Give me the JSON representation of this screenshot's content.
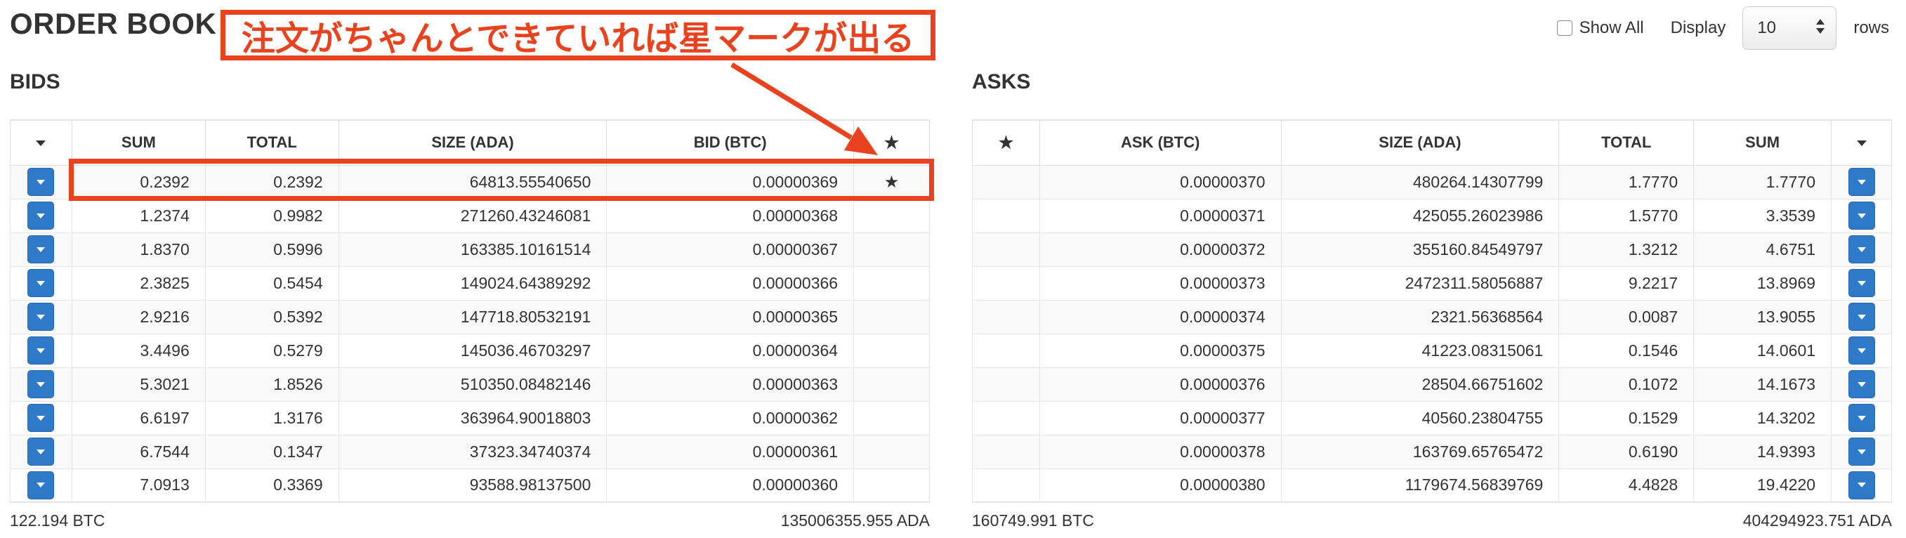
{
  "page": {
    "title": "ORDER BOOK"
  },
  "controls": {
    "show_all_label": "Show All",
    "display_label": "Display",
    "rows_value": "10",
    "rows_label": "rows"
  },
  "colors": {
    "accent": "#e8431e",
    "button": "#2f79c9",
    "stripe": "#f9f9f9"
  },
  "icons": {
    "sort": "caret-down-icon",
    "star": "star-icon",
    "row_button": "caret-down-icon"
  },
  "annotation": {
    "text": "注文がちゃんとできていれば星マークが出る"
  },
  "bids": {
    "title": "BIDS",
    "headers": {
      "sum": "SUM",
      "total": "TOTAL",
      "size": "SIZE (ADA)",
      "price": "BID (BTC)",
      "star": "★"
    },
    "rows": [
      {
        "sum": "0.2392",
        "total": "0.2392",
        "size": "64813.55540650",
        "price": "0.00000369",
        "star": "★"
      },
      {
        "sum": "1.2374",
        "total": "0.9982",
        "size": "271260.43246081",
        "price": "0.00000368",
        "star": ""
      },
      {
        "sum": "1.8370",
        "total": "0.5996",
        "size": "163385.10161514",
        "price": "0.00000367",
        "star": ""
      },
      {
        "sum": "2.3825",
        "total": "0.5454",
        "size": "149024.64389292",
        "price": "0.00000366",
        "star": ""
      },
      {
        "sum": "2.9216",
        "total": "0.5392",
        "size": "147718.80532191",
        "price": "0.00000365",
        "star": ""
      },
      {
        "sum": "3.4496",
        "total": "0.5279",
        "size": "145036.46703297",
        "price": "0.00000364",
        "star": ""
      },
      {
        "sum": "5.3021",
        "total": "1.8526",
        "size": "510350.08482146",
        "price": "0.00000363",
        "star": ""
      },
      {
        "sum": "6.6197",
        "total": "1.3176",
        "size": "363964.90018803",
        "price": "0.00000362",
        "star": ""
      },
      {
        "sum": "6.7544",
        "total": "0.1347",
        "size": "37323.34740374",
        "price": "0.00000361",
        "star": ""
      },
      {
        "sum": "7.0913",
        "total": "0.3369",
        "size": "93588.98137500",
        "price": "0.00000360",
        "star": ""
      }
    ],
    "footer_left": "122.194 BTC",
    "footer_right": "135006355.955 ADA"
  },
  "asks": {
    "title": "ASKS",
    "headers": {
      "star": "★",
      "price": "ASK (BTC)",
      "size": "SIZE (ADA)",
      "total": "TOTAL",
      "sum": "SUM"
    },
    "rows": [
      {
        "star": "",
        "price": "0.00000370",
        "size": "480264.14307799",
        "total": "1.7770",
        "sum": "1.7770"
      },
      {
        "star": "",
        "price": "0.00000371",
        "size": "425055.26023986",
        "total": "1.5770",
        "sum": "3.3539"
      },
      {
        "star": "",
        "price": "0.00000372",
        "size": "355160.84549797",
        "total": "1.3212",
        "sum": "4.6751"
      },
      {
        "star": "",
        "price": "0.00000373",
        "size": "2472311.58056887",
        "total": "9.2217",
        "sum": "13.8969"
      },
      {
        "star": "",
        "price": "0.00000374",
        "size": "2321.56368564",
        "total": "0.0087",
        "sum": "13.9055"
      },
      {
        "star": "",
        "price": "0.00000375",
        "size": "41223.08315061",
        "total": "0.1546",
        "sum": "14.0601"
      },
      {
        "star": "",
        "price": "0.00000376",
        "size": "28504.66751602",
        "total": "0.1072",
        "sum": "14.1673"
      },
      {
        "star": "",
        "price": "0.00000377",
        "size": "40560.23804755",
        "total": "0.1529",
        "sum": "14.3202"
      },
      {
        "star": "",
        "price": "0.00000378",
        "size": "163769.65765472",
        "total": "0.6190",
        "sum": "14.9393"
      },
      {
        "star": "",
        "price": "0.00000380",
        "size": "1179674.56839769",
        "total": "4.4828",
        "sum": "19.4220"
      }
    ],
    "footer_left": "160749.991 BTC",
    "footer_right": "404294923.751 ADA"
  }
}
